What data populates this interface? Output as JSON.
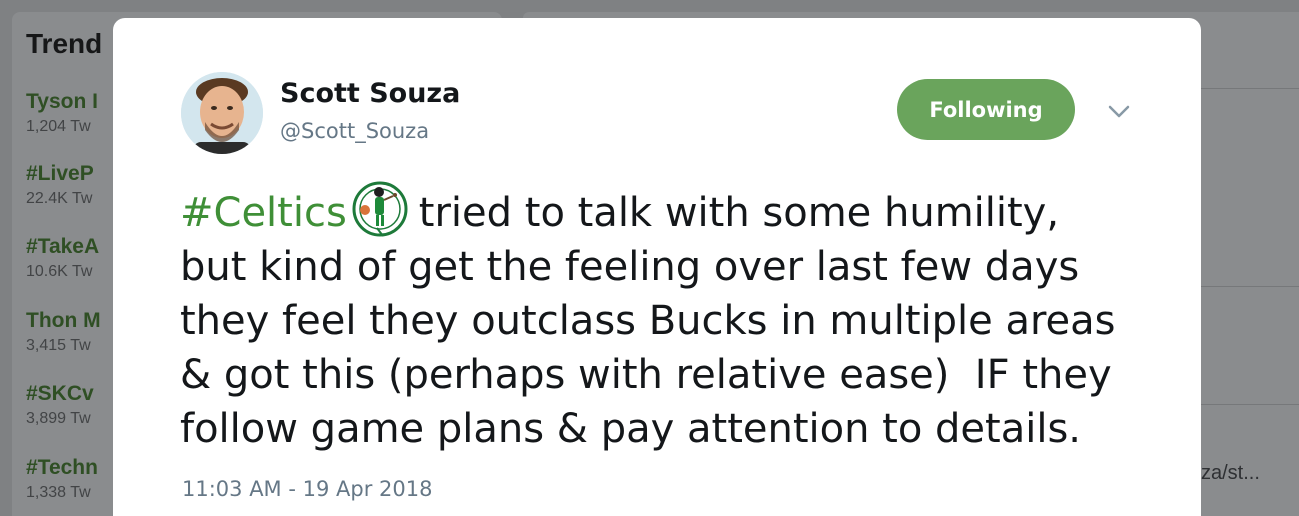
{
  "background": {
    "trends_title": "Trend",
    "trends": [
      {
        "name": "Tyson I",
        "count": "1,204 Tw"
      },
      {
        "name": "#LiveP",
        "count": "22.4K Tw"
      },
      {
        "name": "#TakeA",
        "count": "10.6K Tw"
      },
      {
        "name": "Thon M",
        "count": "3,415 Tw"
      },
      {
        "name": "#SKCv",
        "count": "3,899 Tw"
      },
      {
        "name": "#Techn",
        "count": "1,338 Tw"
      }
    ],
    "right_link": "za/st..."
  },
  "tweet": {
    "author_name": "Scott Souza",
    "author_handle": "@Scott_Souza",
    "follow_label": "Following",
    "hashtag": "#Celtics",
    "line1_rest": "tried to talk with some humility,",
    "line2": "but kind of get the feeling over last few days",
    "line3": "they feel they outclass Bucks in multiple areas",
    "line4": "& got this (perhaps with relative ease)  IF they",
    "line5": "follow game plans & pay attention to details.",
    "timestamp": "11:03 AM - 19 Apr 2018",
    "emoji": "celtics-logo-icon"
  },
  "colors": {
    "accent": "#6aa45c",
    "hashtag": "#3f8f37",
    "secondary_text": "#657786",
    "overlay": "#7f8183"
  }
}
